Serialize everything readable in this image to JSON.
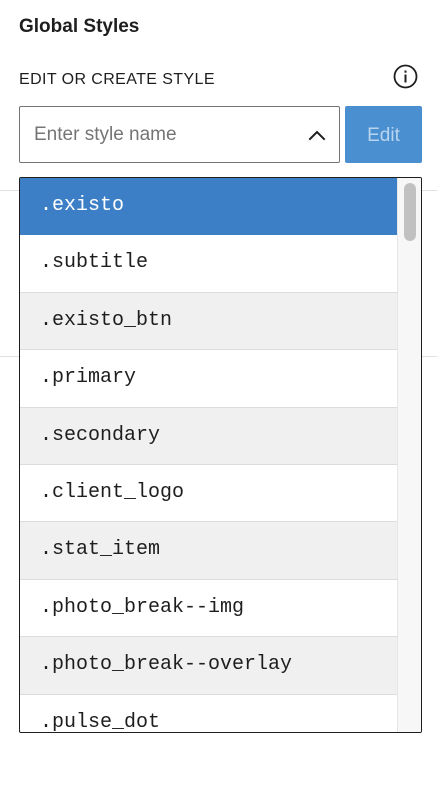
{
  "panel": {
    "title": "Global Styles",
    "section_label": "EDIT OR CREATE STYLE",
    "info_icon": "info-icon"
  },
  "style_input": {
    "placeholder": "Enter style name",
    "value": "",
    "toggle_icon": "chevron-up-icon"
  },
  "edit_button": {
    "label": "Edit",
    "enabled": false
  },
  "dropdown": {
    "selected_index": 0,
    "options": [
      ".existo",
      ".subtitle",
      ".existo_btn",
      ".primary",
      ".secondary",
      ".client_logo",
      ".stat_item",
      ".photo_break--img",
      ".photo_break--overlay",
      ".pulse_dot"
    ]
  },
  "colors": {
    "accent": "#3d7fc7",
    "button_bg": "#4a90d0",
    "button_text_disabled": "#b9d4ee",
    "row_alt": "#f0f0f0",
    "text": "#1e1e1e",
    "placeholder": "#757575"
  }
}
